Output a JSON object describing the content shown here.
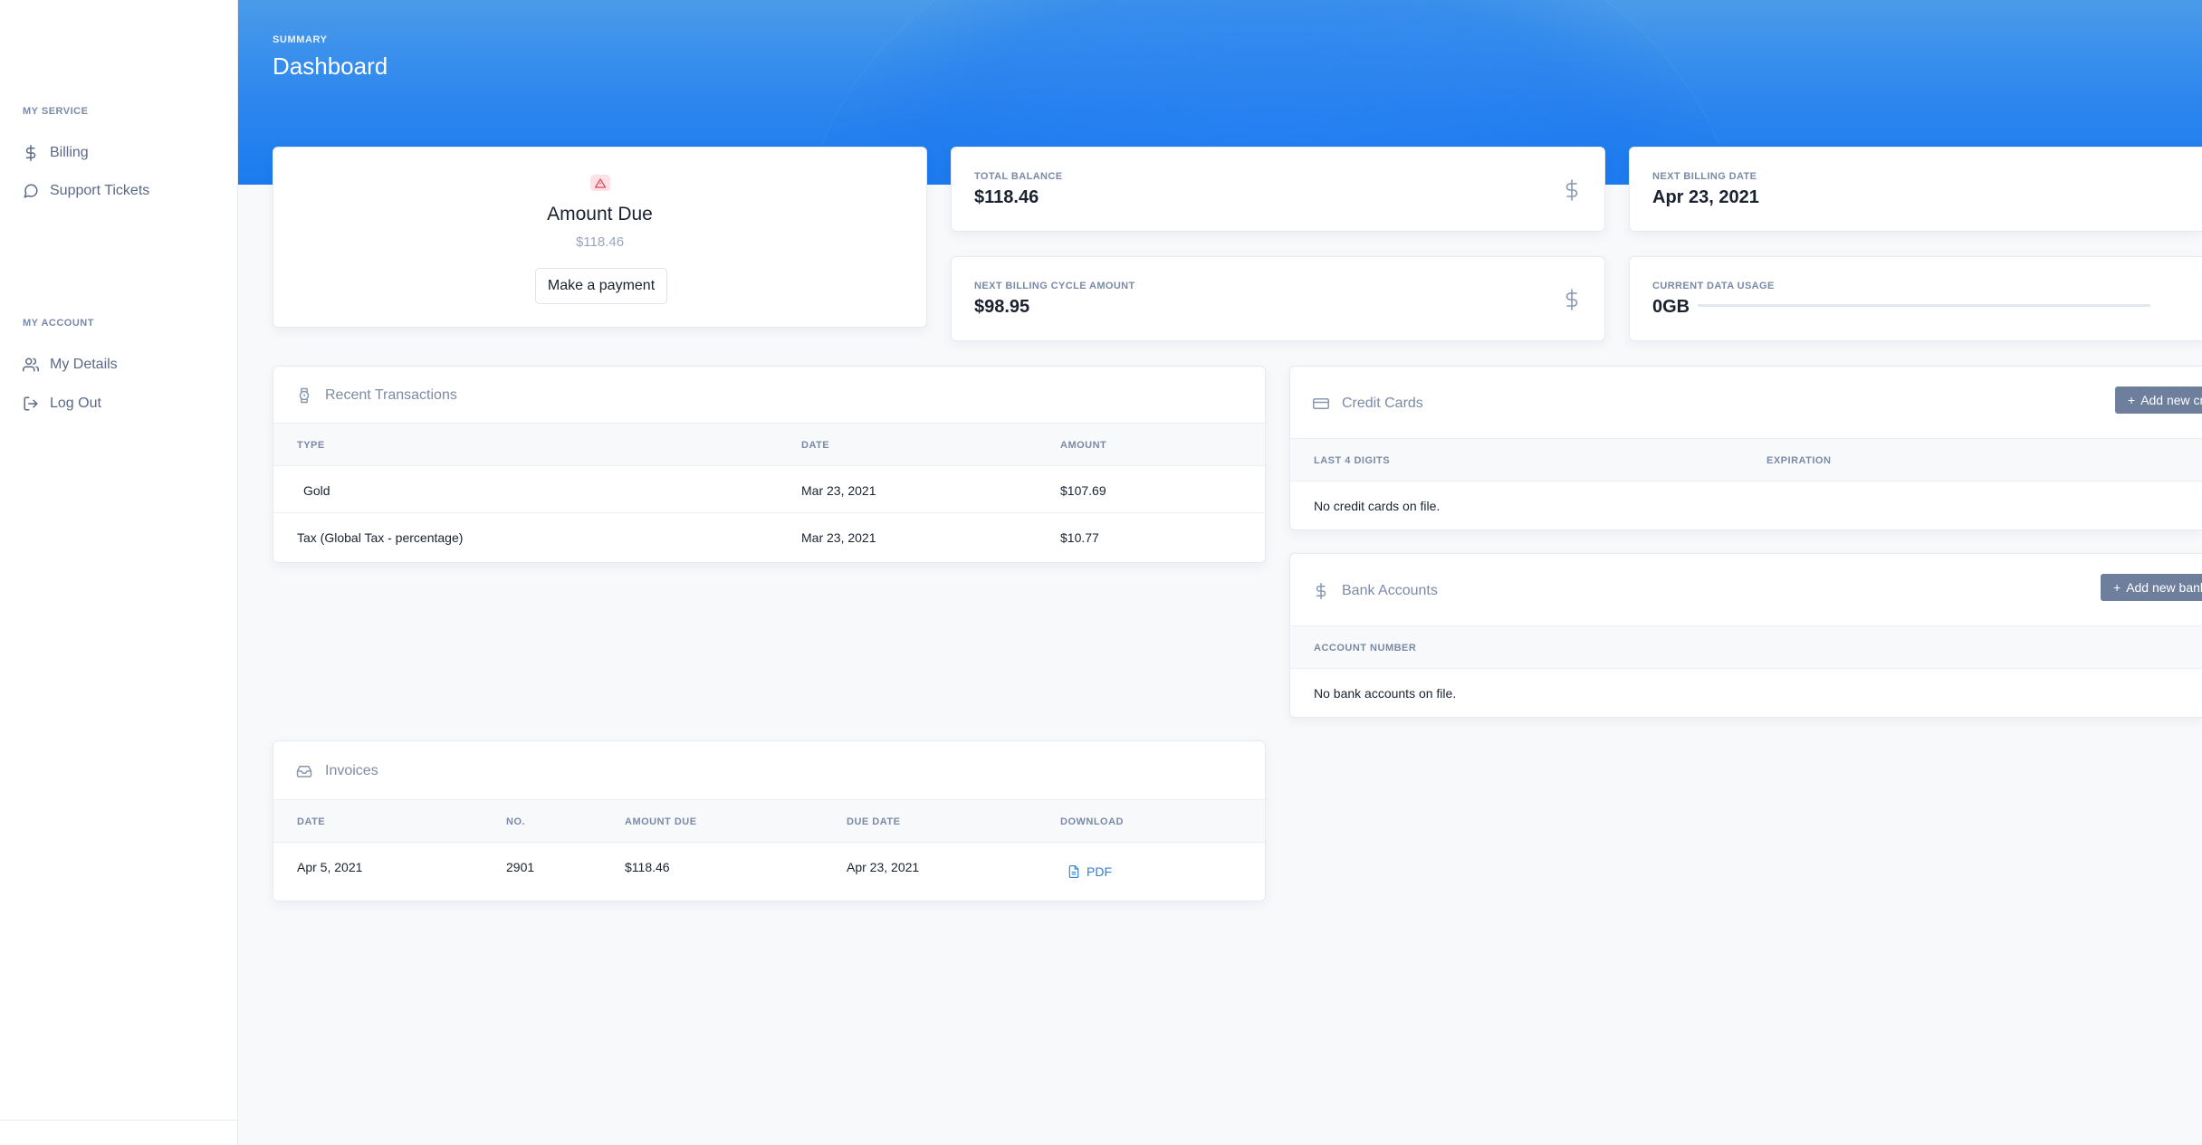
{
  "sidebar": {
    "sections": [
      {
        "label": "MY SERVICE",
        "items": [
          {
            "label": "Billing",
            "icon": "dollar-icon"
          },
          {
            "label": "Support Tickets",
            "icon": "chat-bubble-icon"
          }
        ]
      },
      {
        "label": "MY ACCOUNT",
        "items": [
          {
            "label": "My Details",
            "icon": "users-icon"
          },
          {
            "label": "Log Out",
            "icon": "logout-icon"
          }
        ]
      }
    ]
  },
  "header": {
    "eyebrow": "SUMMARY",
    "title": "Dashboard"
  },
  "amount_due": {
    "title": "Amount Due",
    "value": "$118.46",
    "button_label": "Make a payment"
  },
  "stats": {
    "total_balance": {
      "label": "TOTAL BALANCE",
      "value": "$118.46"
    },
    "next_billing_date": {
      "label": "NEXT BILLING DATE",
      "value": "Apr 23, 2021"
    },
    "next_cycle_amount": {
      "label": "NEXT BILLING CYCLE AMOUNT",
      "value": "$98.95"
    },
    "data_usage": {
      "label": "CURRENT DATA USAGE",
      "value": "0GB"
    }
  },
  "transactions": {
    "title": "Recent Transactions",
    "columns": [
      "TYPE",
      "DATE",
      "AMOUNT"
    ],
    "rows": [
      {
        "type": "Gold",
        "date": "Mar 23, 2021",
        "amount": "$107.69"
      },
      {
        "type": "Tax (Global Tax - percentage)",
        "date": "Mar 23, 2021",
        "amount": "$10.77"
      }
    ]
  },
  "credit_cards": {
    "title": "Credit Cards",
    "add_label": "Add new credit card",
    "columns": [
      "LAST 4 DIGITS",
      "EXPIRATION"
    ],
    "empty": "No credit cards on file."
  },
  "bank_accounts": {
    "title": "Bank Accounts",
    "add_label": "Add new bank account",
    "columns": [
      "ACCOUNT NUMBER"
    ],
    "empty": "No bank accounts on file."
  },
  "invoices": {
    "title": "Invoices",
    "columns": [
      "DATE",
      "NO.",
      "AMOUNT DUE",
      "DUE DATE",
      "DOWNLOAD"
    ],
    "rows": [
      {
        "date": "Apr 5, 2021",
        "no": "2901",
        "amount_due": "$118.46",
        "due_date": "Apr 23, 2021",
        "download": "PDF"
      }
    ]
  },
  "colors": {
    "accent": "#1b7bee",
    "muted": "#7a8aa6",
    "button_gray": "#6d7f9c",
    "warn_bg": "#fde1e4",
    "warn": "#e0465a"
  }
}
